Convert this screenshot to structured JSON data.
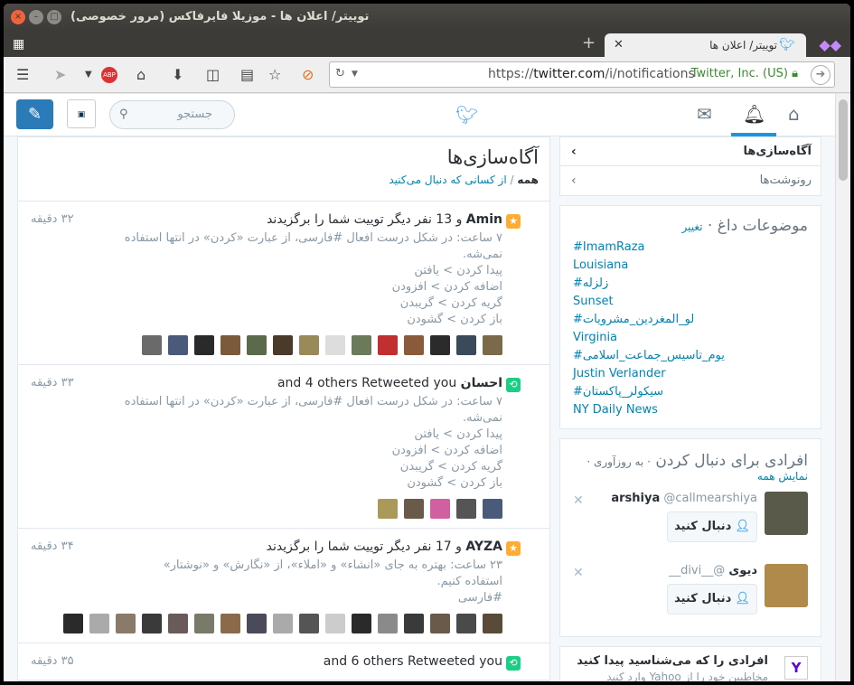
{
  "window": {
    "title": "توییتر/ اعلان ها - موزیلا فایرفاکس (مرور خصوصی)"
  },
  "tab": {
    "label": "توییتر/ اعلان ها"
  },
  "url": {
    "prefix": "https://",
    "domain": "twitter.com",
    "path": "/i/notifications",
    "identity": "Twitter, Inc. (US)"
  },
  "twitter": {
    "search_placeholder": "جستجو"
  },
  "main": {
    "title": "آگاه‌سازی‌ها",
    "filter_all": "همه",
    "filter_sep": " / ",
    "filter_following": "از کسانی که دنبال می‌کنید"
  },
  "notifications": [
    {
      "type": "star",
      "name": "Amin",
      "text": " و 13 نفر دیگر توییت شما را برگزیدند",
      "time": "۳۲ دقیقه",
      "tweet": [
        "۷ ساعت: در شکل درست افعال #فارسی، از عبارت «کردن» در انتها استفاده",
        "نمی‌شه.",
        "پیدا کردن > یافتن",
        "اضافه کردن > افزودن",
        "گریه کردن > گریبدن",
        "باز کردن > گشودن"
      ],
      "avatar_colors": [
        "#7a6a4a",
        "#3a4a5a",
        "#2b2b2b",
        "#8a5a3a",
        "#c03030",
        "#6a7a5a",
        "#ddd",
        "#9a8a5a",
        "#4a3a2a",
        "#5a6a4a",
        "#7a5a3a",
        "#2a2a2a",
        "#4a5a7a",
        "#6a6a6a"
      ]
    },
    {
      "type": "retweet",
      "name": "احسان",
      "text": " and 4 others Retweeted you",
      "time": "۳۳ دقیقه",
      "tweet": [
        "۷ ساعت: در شکل درست افعال #فارسی، از عبارت «کردن» در انتها استفاده",
        "نمی‌شه.",
        "پیدا کردن > یافتن",
        "اضافه کردن > افزودن",
        "گریه کردن > گریبدن",
        "باز کردن > گشودن"
      ],
      "avatar_colors": [
        "#4a5a7a",
        "#555",
        "#d060a0",
        "#6a5a4a",
        "#aa9a5a"
      ]
    },
    {
      "type": "star",
      "name": "AYZA",
      "text": " و 17 نفر دیگر توییت شما را برگزیدند",
      "time": "۳۴ دقیقه",
      "tweet": [
        "۲۳ ساعت: بهتره به جای «انشاء» و «املاء»، از «نگارش» و «نوشتار»",
        "استفاده کنیم.",
        "#فارسی"
      ],
      "avatar_colors": [
        "#5a4a3a",
        "#4a4a4a",
        "#6a5a4a",
        "#3a3a3a",
        "#8a8a8a",
        "#2a2a2a",
        "#ccc",
        "#555",
        "#aaa",
        "#4a4a5a",
        "#8a6a4a",
        "#7a7a6a",
        "#6a5a5a",
        "#3a3a3a",
        "#8a7a6a",
        "#aaa",
        "#2a2a2a"
      ]
    },
    {
      "type": "retweet",
      "name": "",
      "text": "and 6 others Retweeted you",
      "time": "۳۵ دقیقه",
      "tweet": [],
      "avatar_colors": []
    }
  ],
  "side": {
    "menu": [
      {
        "label": "آگاه‌سازی‌ها"
      },
      {
        "label": "رونوشت‌ها"
      }
    ],
    "trends_title": "موضوعات داغ",
    "trends_change": "تغییر",
    "trends": [
      "#ImamRaza",
      "Louisiana",
      "#زلزله",
      "Sunset",
      "#لو_المغردین_مشرویات",
      "Virginia",
      "#یوم_تاسیس_جماعت_اسلامی",
      "Justin Verlander",
      "#سیکولر_پاکستان",
      "NY Daily News"
    ],
    "wtf_title": "افرادی برای دنبال کردن",
    "wtf_refresh": "به روزآوری",
    "wtf_showall": "نمایش همه",
    "suggestions": [
      {
        "name": "arshiya",
        "handle": "@callmearshiya",
        "follow": "دنبال کنید",
        "pic_color": "#5a5a4a"
      },
      {
        "name": "دیوی",
        "handle": "@__divi__",
        "follow": "دنبال کنید",
        "pic_color": "#b08a4a"
      }
    ],
    "find_title": "افرادی را که می‌شناسید پیدا کنید",
    "find_sub": "مخاطبین خود را از Yahoo وارد کنید"
  }
}
